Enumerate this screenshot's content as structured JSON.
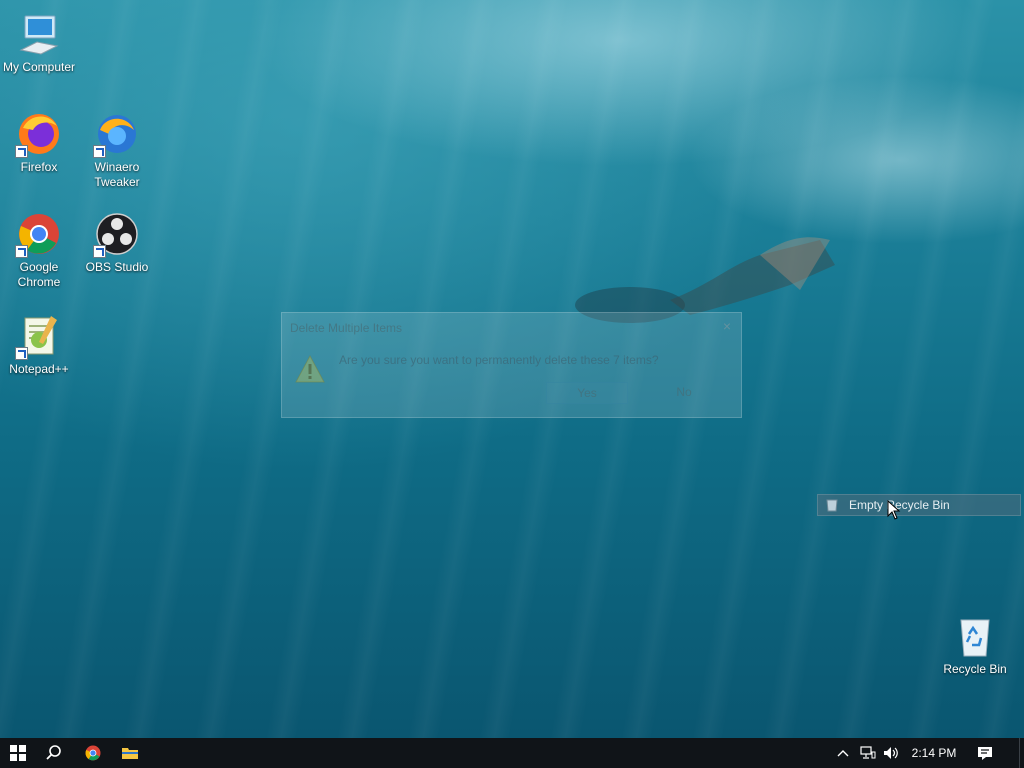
{
  "desktop": {
    "icons": [
      {
        "label_line1": "My Computer",
        "label_line2": ""
      },
      {
        "label_line1": "Firefox",
        "label_line2": ""
      },
      {
        "label_line1": "Winaero",
        "label_line2": "Tweaker"
      },
      {
        "label_line1": "Google",
        "label_line2": "Chrome"
      },
      {
        "label_line1": "OBS Studio",
        "label_line2": ""
      },
      {
        "label_line1": "Notepad++",
        "label_line2": ""
      },
      {
        "label_line1": "Recycle Bin",
        "label_line2": ""
      }
    ]
  },
  "dialog": {
    "title": "Delete Multiple Items",
    "close_symbol": "×",
    "message": "Are you sure you want to permanently delete these 7 items?",
    "yes_label": "Yes",
    "no_label": "No"
  },
  "context_menu": {
    "item_label": "Empty Recycle Bin",
    "item_icon": "recycle-bin-icon"
  },
  "taskbar": {
    "time": "2:14 PM",
    "pinned": [
      "start-icon",
      "search-icon",
      "chrome-icon",
      "file-explorer-icon"
    ],
    "tray_icons": [
      "chevron-up-icon",
      "network-icon",
      "volume-icon",
      "action-center-icon"
    ]
  },
  "colors": {
    "taskbar": "#101418",
    "accent": "#1f5fbf"
  }
}
